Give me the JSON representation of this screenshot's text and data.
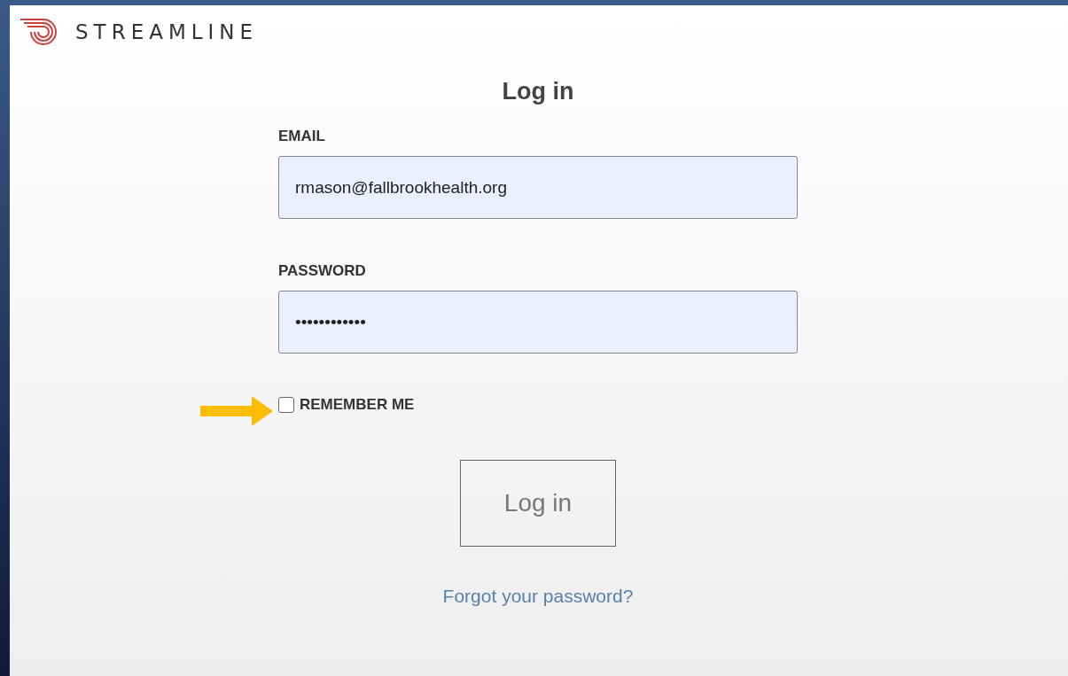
{
  "brand": {
    "name": "STREAMLINE"
  },
  "form": {
    "title": "Log in",
    "fields": [
      {
        "label": "EMAIL",
        "value": "rmason@fallbrookhealth.org"
      },
      {
        "label": "PASSWORD",
        "value": "••••••••••••"
      }
    ],
    "remember": {
      "label": "REMEMBER ME",
      "checked": false
    },
    "submit": "Log in",
    "forgot_link": "Forgot your password?"
  }
}
